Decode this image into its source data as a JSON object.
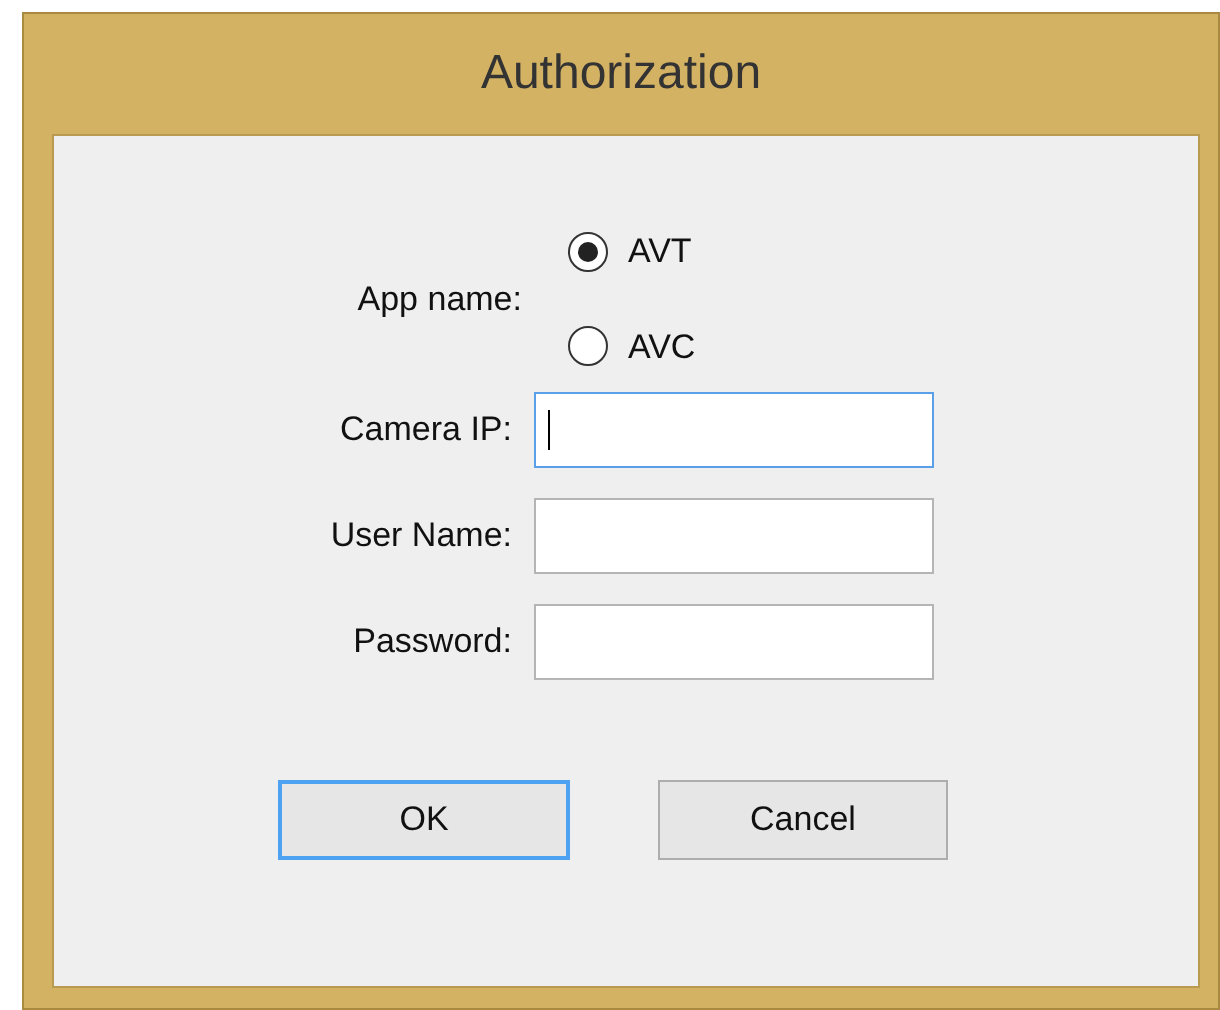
{
  "window": {
    "title": "Authorization"
  },
  "app_name": {
    "label": "App name:",
    "options": [
      {
        "label": "AVT",
        "selected": true
      },
      {
        "label": "AVC",
        "selected": false
      }
    ]
  },
  "fields": [
    {
      "label": "Camera IP:",
      "focused": true
    },
    {
      "label": "User Name:",
      "focused": false
    },
    {
      "label": "Password:",
      "focused": false
    }
  ],
  "buttons": [
    {
      "label": "OK",
      "default": true
    },
    {
      "label": "Cancel",
      "default": false
    }
  ]
}
